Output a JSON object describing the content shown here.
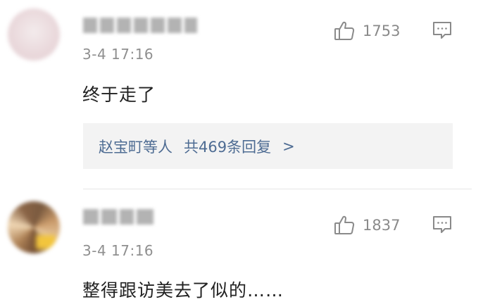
{
  "comments": [
    {
      "time": "3-4 17:16",
      "likes": "1753",
      "text": "终于走了",
      "replies": {
        "users": "赵宝町等人",
        "summary": "共469条回复",
        "arrow": ">"
      }
    },
    {
      "time": "3-4 17:16",
      "likes": "1837",
      "text": "整得跟访美去了似的……"
    }
  ],
  "icons": {
    "like": "thumbs-up-icon",
    "reply": "comment-bubble-icon"
  },
  "colors": {
    "link": "#4e6c93",
    "meta": "#8f8f8f",
    "reply_bg": "#f3f3f3"
  }
}
